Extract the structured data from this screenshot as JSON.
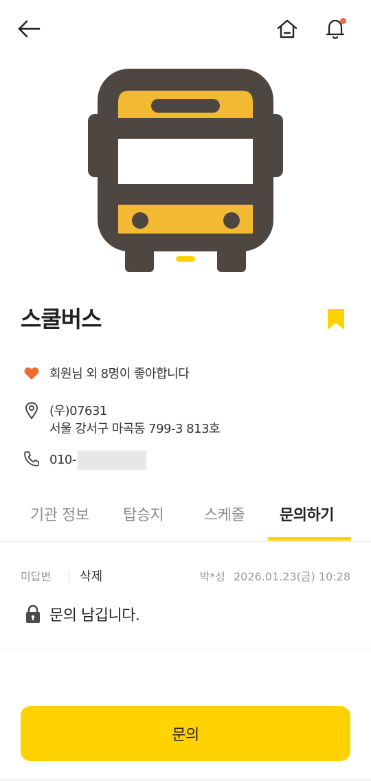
{
  "colors": {
    "accent": "#FFD200",
    "bus_yellow": "#F2B933",
    "bus_dark": "#4E4640",
    "heart": "#F26A2E",
    "notify_dot": "#F26A45"
  },
  "header": {
    "back_icon": "arrow-left-icon",
    "home_icon": "home-icon",
    "bell_icon": "bell-icon"
  },
  "org": {
    "name": "스쿨버스",
    "likes_text": "회원님 외 8명이 좋아합니다",
    "postal": "(우)07631",
    "address": "서울 강서구 마곡동 799-3 813호",
    "phone_prefix": "010-"
  },
  "tabs": [
    {
      "label": "기관 정보"
    },
    {
      "label": "탑승지"
    },
    {
      "label": "스케줄"
    },
    {
      "label": "문의하기"
    }
  ],
  "inquiry": {
    "status": "미답변",
    "delete_label": "삭제",
    "writer": "박*성",
    "date": "2026.01.23(금) 10:28",
    "text": "문의 남깁니다."
  },
  "cta_label": "문의"
}
